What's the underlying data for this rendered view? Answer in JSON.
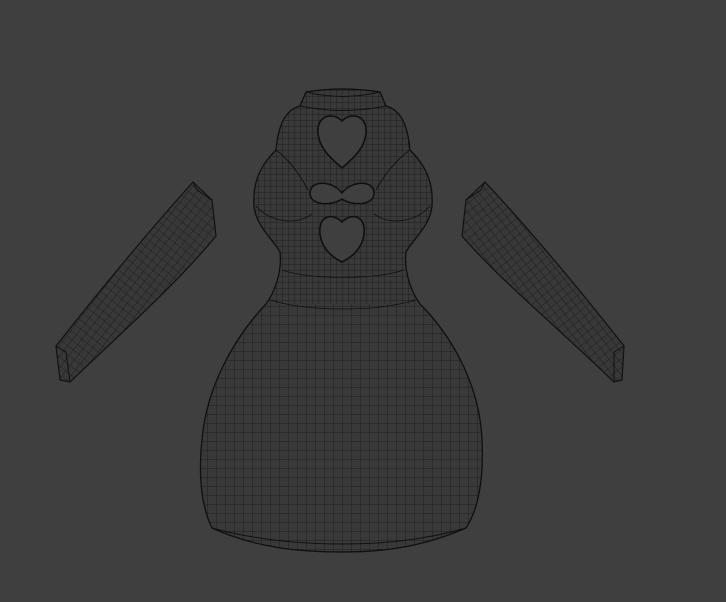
{
  "viewport": {
    "background_color": "#3f3f3f",
    "mesh_fill_color": "#3a3a3a",
    "wire_color": "#1a1a1a",
    "object_name": "",
    "mode": "wireframe"
  }
}
